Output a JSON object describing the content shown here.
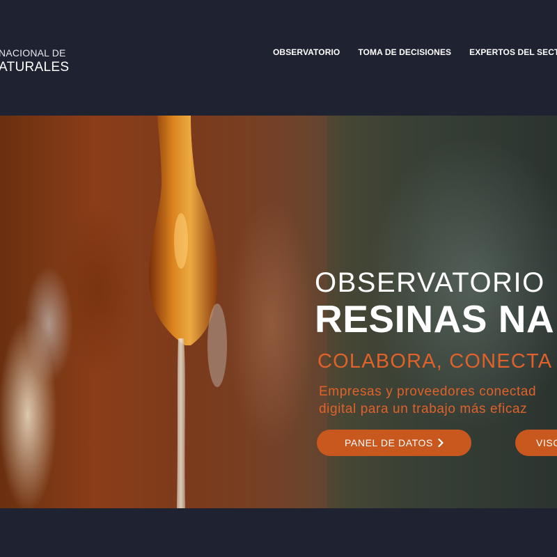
{
  "header": {
    "logo_line1": "NACIONAL DE",
    "logo_line2": "ATURALES",
    "nav": [
      {
        "label": "OBSERVATORIO"
      },
      {
        "label": "TOMA DE DECISIONES"
      },
      {
        "label": "EXPERTOS DEL SECTOR"
      }
    ]
  },
  "hero": {
    "title_light": "OBSERVATORIO",
    "title_bold": "RESINAS NA",
    "tagline": "COLABORA, CONECTA",
    "description_line1": "Empresas y proveedores conectad",
    "description_line2": "digital para un trabajo más eficaz",
    "buttons": {
      "panel_label": "PANEL DE DATOS",
      "visor_label": "VISO"
    }
  },
  "colors": {
    "background": "#1f2231",
    "accent": "#e0622a",
    "button": "#c9581e"
  },
  "icons": {
    "button_arrow": "chevron-right-icon"
  }
}
